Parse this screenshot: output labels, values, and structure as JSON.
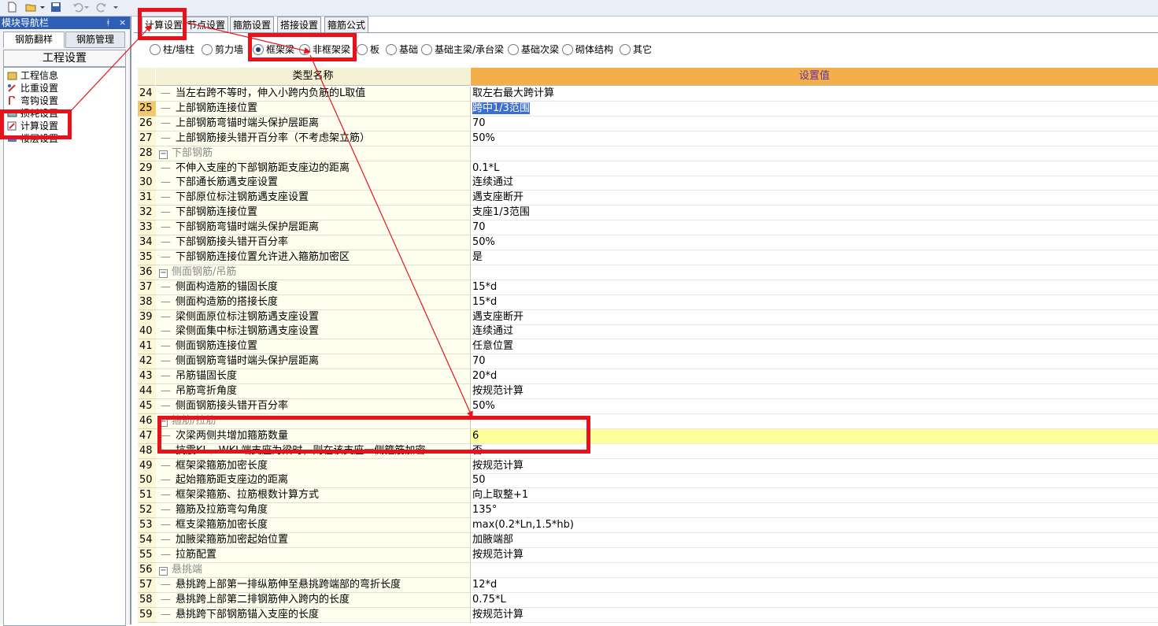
{
  "nav": {
    "title": "模块导航栏",
    "pin": "ᚼ",
    "close": "×",
    "tabs": [
      "钢筋翻样",
      "钢筋管理"
    ],
    "section_title": "工程设置",
    "items": [
      "工程信息",
      "比重设置",
      "弯钩设置",
      "损耗设置",
      "计算设置",
      "楼层设置"
    ]
  },
  "tabs": [
    "计算设置",
    "节点设置",
    "箍筋设置",
    "搭接设置",
    "箍筋公式"
  ],
  "radios": {
    "options": [
      "柱/墙柱",
      "剪力墙",
      "框架梁",
      "非框架梁",
      "板",
      "基础",
      "基础主梁/承台梁",
      "基础次梁",
      "砌体结构",
      "其它"
    ],
    "selected": "框架梁"
  },
  "grid": {
    "col_name": "类型名称",
    "col_value": "设置值",
    "rows": [
      {
        "n": "24",
        "name": "当左右跨不等时，伸入小跨内负筋的L取值",
        "value": "取左右最大跨计算"
      },
      {
        "n": "25",
        "name": "上部钢筋连接位置",
        "value": "跨中1/3范围"
      },
      {
        "n": "26",
        "name": "上部钢筋弯锚时端头保护层距离",
        "value": "70"
      },
      {
        "n": "27",
        "name": "上部钢筋接头错开百分率（不考虑架立筋）",
        "value": "50%"
      },
      {
        "n": "28",
        "name": "下部钢筋",
        "value": ""
      },
      {
        "n": "29",
        "name": "不伸入支座的下部钢筋距支座边的距离",
        "value": "0.1*L"
      },
      {
        "n": "30",
        "name": "下部通长筋遇支座设置",
        "value": "连续通过"
      },
      {
        "n": "31",
        "name": "下部原位标注钢筋遇支座设置",
        "value": "遇支座断开"
      },
      {
        "n": "32",
        "name": "下部钢筋连接位置",
        "value": "支座1/3范围"
      },
      {
        "n": "33",
        "name": "下部钢筋弯锚时端头保护层距离",
        "value": "70"
      },
      {
        "n": "34",
        "name": "下部钢筋接头错开百分率",
        "value": "50%"
      },
      {
        "n": "35",
        "name": "下部钢筋连接位置允许进入箍筋加密区",
        "value": "是"
      },
      {
        "n": "36",
        "name": "侧面钢筋/吊筋",
        "value": ""
      },
      {
        "n": "37",
        "name": "侧面构造筋的锚固长度",
        "value": "15*d"
      },
      {
        "n": "38",
        "name": "侧面构造筋的搭接长度",
        "value": "15*d"
      },
      {
        "n": "39",
        "name": "梁侧面原位标注钢筋遇支座设置",
        "value": "遇支座断开"
      },
      {
        "n": "40",
        "name": "梁侧面集中标注钢筋遇支座设置",
        "value": "连续通过"
      },
      {
        "n": "41",
        "name": "侧面钢筋连接位置",
        "value": "任意位置"
      },
      {
        "n": "42",
        "name": "侧面钢筋弯锚时端头保护层距离",
        "value": "70"
      },
      {
        "n": "43",
        "name": "吊筋锚固长度",
        "value": "20*d"
      },
      {
        "n": "44",
        "name": "吊筋弯折角度",
        "value": "按规范计算"
      },
      {
        "n": "45",
        "name": "侧面钢筋接头错开百分率",
        "value": "50%"
      },
      {
        "n": "46",
        "name": "箍筋/拉筋",
        "value": ""
      },
      {
        "n": "47",
        "name": "次梁两侧共增加箍筋数量",
        "value": "6"
      },
      {
        "n": "48",
        "name": "抗震KL、WKL端支座为梁时，则在该支座一侧箍筋加密",
        "value": "否"
      },
      {
        "n": "49",
        "name": "框架梁箍筋加密长度",
        "value": "按规范计算"
      },
      {
        "n": "50",
        "name": "起始箍筋距支座边的距离",
        "value": "50"
      },
      {
        "n": "51",
        "name": "框架梁箍筋、拉筋根数计算方式",
        "value": "向上取整+1"
      },
      {
        "n": "52",
        "name": "箍筋及拉筋弯勾角度",
        "value": "135°"
      },
      {
        "n": "53",
        "name": "框支梁箍筋加密长度",
        "value": "max(0.2*Ln,1.5*hb)"
      },
      {
        "n": "54",
        "name": "加腋梁箍筋加密起始位置",
        "value": "加腋端部"
      },
      {
        "n": "55",
        "name": "拉筋配置",
        "value": "按规范计算"
      },
      {
        "n": "56",
        "name": "悬挑端",
        "value": ""
      },
      {
        "n": "57",
        "name": "悬挑跨上部第一排纵筋伸至悬挑跨端部的弯折长度",
        "value": "12*d"
      },
      {
        "n": "58",
        "name": "悬挑跨上部第二排钢筋伸入跨内的长度",
        "value": "0.75*L"
      },
      {
        "n": "59",
        "name": "悬挑跨下部钢筋锚入支座的长度",
        "value": "按规范计算"
      }
    ]
  },
  "colors": {
    "annotation": "#e8121c",
    "group_text": "#8a8a8a",
    "selected_cell": "#3a6fd0",
    "highlight_row": "#ffff99",
    "header_value": "#f2b04a"
  }
}
